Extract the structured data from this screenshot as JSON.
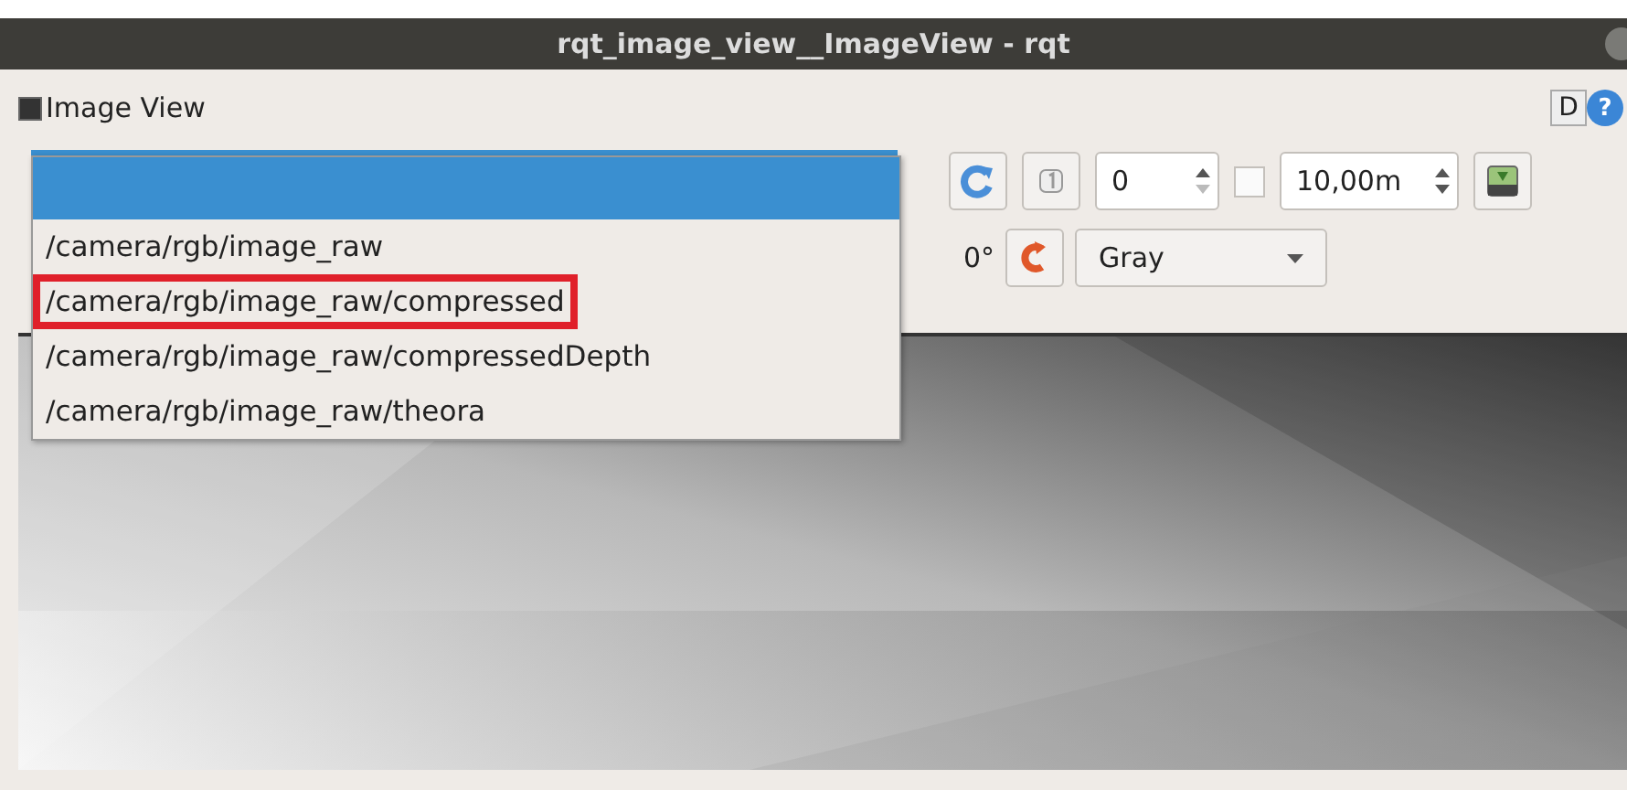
{
  "window": {
    "title": "rqt_image_view__ImageView - rqt"
  },
  "plugin": {
    "title": "Image View",
    "d_label": "D",
    "help_label": "?"
  },
  "toolbar": {
    "frame_spin": {
      "value": "0"
    },
    "smooth_checked": false,
    "timeout_spin": {
      "value": "10,00m"
    },
    "rotation": "0°",
    "color_scheme": "Gray"
  },
  "topic_dropdown": {
    "items": [
      {
        "selected": true,
        "highlighted": false
      },
      {
        "label": "/camera/rgb/image_raw",
        "selected": false,
        "highlighted": false
      },
      {
        "label": "/camera/rgb/image_raw/compressed",
        "selected": false,
        "highlighted": true
      },
      {
        "label": "/camera/rgb/image_raw/compressedDepth",
        "selected": false,
        "highlighted": false
      },
      {
        "label": "/camera/rgb/image_raw/theora",
        "selected": false,
        "highlighted": false
      }
    ]
  }
}
